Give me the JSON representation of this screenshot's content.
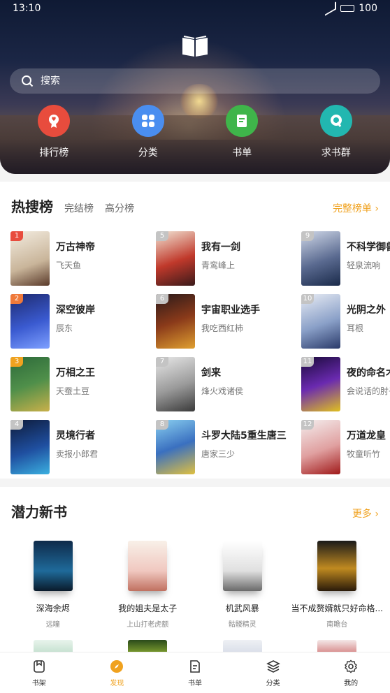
{
  "status_bar": {
    "time": "13:10",
    "battery": "100"
  },
  "search": {
    "placeholder": "搜索"
  },
  "quick_links": [
    {
      "label": "排行榜",
      "icon": "ranking-icon",
      "color": "#e84c3d"
    },
    {
      "label": "分类",
      "icon": "category-icon",
      "color": "#4a8ef0"
    },
    {
      "label": "书单",
      "icon": "booklist-icon",
      "color": "#3fb54a"
    },
    {
      "label": "求书群",
      "icon": "request-group-icon",
      "color": "#22b7b0"
    }
  ],
  "hot": {
    "title": "热搜榜",
    "tabs": [
      "完结榜",
      "高分榜"
    ],
    "more": "完整榜单",
    "books": [
      {
        "rank": "1",
        "title": "万古神帝",
        "author": "飞天鱼"
      },
      {
        "rank": "2",
        "title": "深空彼岸",
        "author": "辰东"
      },
      {
        "rank": "3",
        "title": "万相之王",
        "author": "天蚕土豆"
      },
      {
        "rank": "4",
        "title": "灵境行者",
        "author": "卖报小郎君"
      },
      {
        "rank": "5",
        "title": "我有一剑",
        "author": "青鸾峰上"
      },
      {
        "rank": "6",
        "title": "宇宙职业选手",
        "author": "我吃西红柿"
      },
      {
        "rank": "7",
        "title": "剑来",
        "author": "烽火戏诸侯"
      },
      {
        "rank": "8",
        "title": "斗罗大陆5重生唐三",
        "author": "唐家三少"
      },
      {
        "rank": "9",
        "title": "不科学御兽",
        "author": "轻泉流响"
      },
      {
        "rank": "10",
        "title": "光阴之外",
        "author": "耳根"
      },
      {
        "rank": "11",
        "title": "夜的命名术",
        "author": "会说话的肘子"
      },
      {
        "rank": "12",
        "title": "万道龙皇",
        "author": "牧童听竹"
      }
    ]
  },
  "new_books": {
    "title": "潜力新书",
    "more": "更多",
    "books": [
      {
        "title": "深海余烬",
        "author": "远瞳"
      },
      {
        "title": "我的姐夫是太子",
        "author": "上山打老虎额"
      },
      {
        "title": "机武风暴",
        "author": "骷髅精灵"
      },
      {
        "title": "当不成赘婿就只好命格...",
        "author": "南瞻台"
      }
    ]
  },
  "bottom_nav": [
    {
      "label": "书架",
      "icon": "bookshelf-icon",
      "active": false
    },
    {
      "label": "发现",
      "icon": "discover-icon",
      "active": true
    },
    {
      "label": "书单",
      "icon": "booklist-icon",
      "active": false
    },
    {
      "label": "分类",
      "icon": "category-icon",
      "active": false
    },
    {
      "label": "我的",
      "icon": "settings-icon",
      "active": false
    }
  ],
  "colors": {
    "accent": "#f0a21f",
    "rank_1": "#e84c3d",
    "rank_2": "#f07a3a",
    "rank_3": "#f0a21f",
    "rank_other": "#c4c4c4"
  }
}
